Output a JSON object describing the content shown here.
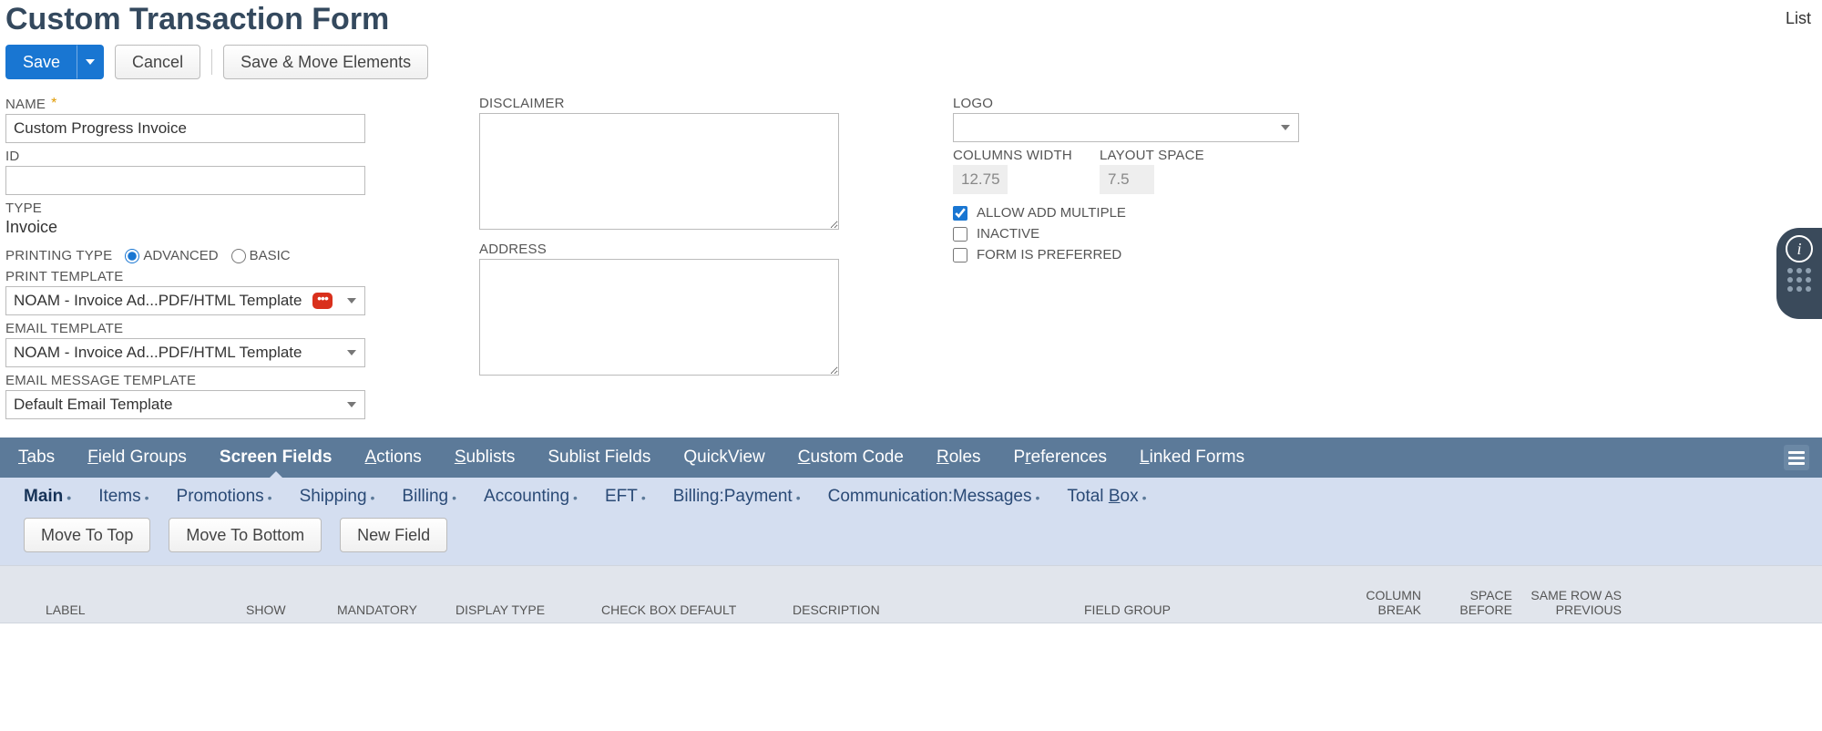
{
  "header": {
    "title": "Custom Transaction Form",
    "list_link": "List"
  },
  "actions": {
    "save": "Save",
    "cancel": "Cancel",
    "save_move": "Save & Move Elements"
  },
  "fields": {
    "name_label": "NAME",
    "name_value": "Custom Progress Invoice",
    "id_label": "ID",
    "id_value": "",
    "type_label": "TYPE",
    "type_value": "Invoice",
    "printing_type_label": "PRINTING TYPE",
    "printing_advanced": "ADVANCED",
    "printing_basic": "BASIC",
    "print_template_label": "PRINT TEMPLATE",
    "print_template_value": "NOAM - Invoice Ad...PDF/HTML Template",
    "email_template_label": "EMAIL TEMPLATE",
    "email_template_value": "NOAM - Invoice Ad...PDF/HTML Template",
    "email_msg_template_label": "EMAIL MESSAGE TEMPLATE",
    "email_msg_template_value": "Default Email Template",
    "disclaimer_label": "DISCLAIMER",
    "disclaimer_value": "",
    "address_label": "ADDRESS",
    "address_value": "",
    "logo_label": "LOGO",
    "logo_value": "",
    "columns_width_label": "COLUMNS WIDTH",
    "columns_width_value": "12.75",
    "layout_space_label": "LAYOUT SPACE",
    "layout_space_value": "7.5",
    "allow_add_multiple": "ALLOW ADD MULTIPLE",
    "inactive": "INACTIVE",
    "form_preferred": "FORM IS PREFERRED"
  },
  "tabs": {
    "items": [
      "Tabs",
      "Field Groups",
      "Screen Fields",
      "Actions",
      "Sublists",
      "Sublist Fields",
      "QuickView",
      "Custom Code",
      "Roles",
      "Preferences",
      "Linked Forms"
    ],
    "active_index": 2
  },
  "subtabs": {
    "items": [
      "Main",
      "Items",
      "Promotions",
      "Shipping",
      "Billing",
      "Accounting",
      "EFT",
      "Billing:Payment",
      "Communication:Messages",
      "Total Box"
    ],
    "active_index": 0
  },
  "subtab_buttons": {
    "move_top": "Move To Top",
    "move_bottom": "Move To Bottom",
    "new_field": "New Field"
  },
  "grid": {
    "headers": [
      "LABEL",
      "SHOW",
      "MANDATORY",
      "DISPLAY TYPE",
      "CHECK BOX DEFAULT",
      "DESCRIPTION",
      "FIELD GROUP",
      "COLUMN BREAK",
      "SPACE BEFORE",
      "SAME ROW AS PREVIOUS"
    ]
  }
}
